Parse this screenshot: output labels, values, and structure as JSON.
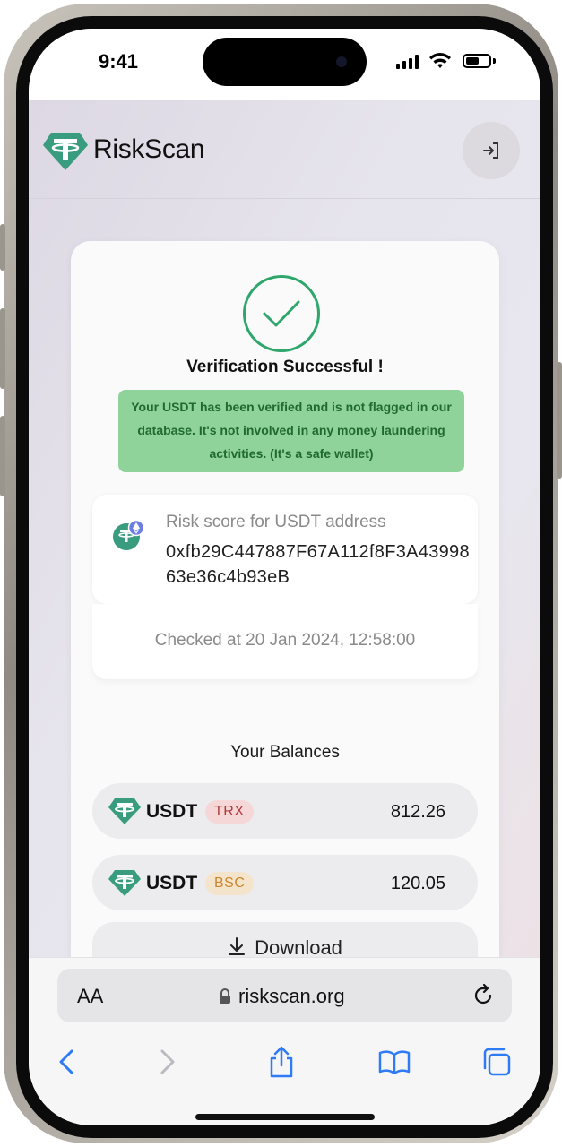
{
  "status_bar": {
    "time": "9:41"
  },
  "site": {
    "name": "RiskScan",
    "login_icon": "log-in-icon"
  },
  "result": {
    "title": "Verification Successful !",
    "notice": "Your USDT has been verified and is not flagged in our database. It's not involved in any money laundering activities. (It's a safe wallet)",
    "address_label": "Risk score for USDT address",
    "address": "0xfb29C447887F67A112f8F3A4399863e36c4b93eB",
    "checked_at": "Checked at 20 Jan 2024, 12:58:00"
  },
  "balances": {
    "title": "Your Balances",
    "items": [
      {
        "token": "USDT",
        "network": "TRX",
        "amount": "812.26"
      },
      {
        "token": "USDT",
        "network": "BSC",
        "amount": "120.05"
      }
    ],
    "download_label": "Download"
  },
  "safari": {
    "text_size_label": "AA",
    "url": "riskscan.org"
  },
  "colors": {
    "success": "#2fa66b",
    "notice_bg": "#8fd29a",
    "tether": "#3a9c7e",
    "trx_chip": "#b33a3a",
    "bsc_chip": "#c9872e",
    "ios_blue": "#2f7bf5"
  }
}
